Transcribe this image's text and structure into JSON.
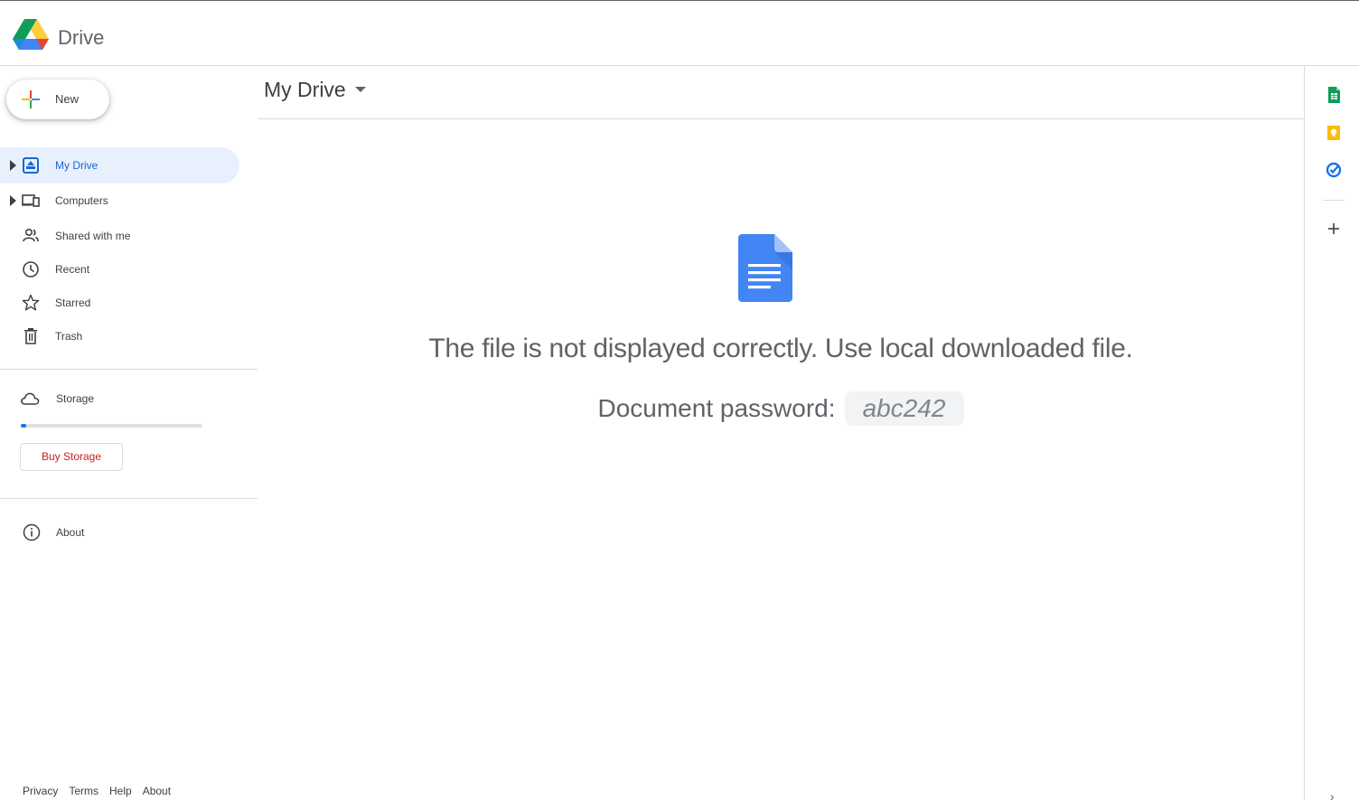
{
  "app": {
    "title": "Drive"
  },
  "sidebar": {
    "new_label": "New",
    "items": [
      {
        "label": "My Drive",
        "icon": "my-drive-icon",
        "active": true
      },
      {
        "label": "Computers",
        "icon": "computers-icon",
        "active": false
      },
      {
        "label": "Shared with me",
        "icon": "shared-icon",
        "active": false
      },
      {
        "label": "Recent",
        "icon": "clock-icon",
        "active": false
      },
      {
        "label": "Starred",
        "icon": "star-icon",
        "active": false
      },
      {
        "label": "Trash",
        "icon": "trash-icon",
        "active": false
      }
    ],
    "storage_label": "Storage",
    "storage_used_fraction": 0.03,
    "buy_storage_label": "Buy Storage",
    "about_label": "About",
    "footer_links": [
      "Privacy",
      "Terms",
      "Help",
      "About"
    ]
  },
  "main": {
    "breadcrumb": "My Drive",
    "message": "The file is not displayed correctly. Use local downloaded file.",
    "password_label": "Document password:",
    "password_value": "abc242"
  },
  "right_panel": {
    "icons": [
      "sheets-icon",
      "keep-icon",
      "tasks-icon",
      "add-icon",
      "chevron-right-icon"
    ]
  },
  "colors": {
    "accent_blue": "#1a73e8",
    "active_bg": "#e8f0fe",
    "buy_text": "#c5221f",
    "docs_blue": "#4285f4",
    "sheets_green": "#0f9d58",
    "keep_yellow": "#fbbc04"
  }
}
